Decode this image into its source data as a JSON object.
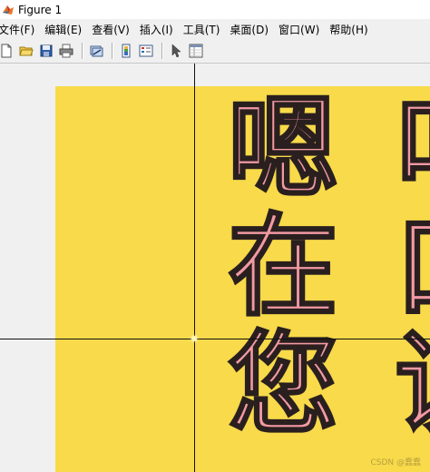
{
  "window": {
    "title": "Figure 1"
  },
  "menu": {
    "items": [
      {
        "label": "文件(F)"
      },
      {
        "label": "编辑(E)"
      },
      {
        "label": "查看(V)"
      },
      {
        "label": "插入(I)"
      },
      {
        "label": "工具(T)"
      },
      {
        "label": "桌面(D)"
      },
      {
        "label": "窗口(W)"
      },
      {
        "label": "帮助(H)"
      }
    ]
  },
  "toolbar": {
    "buttons": [
      {
        "icon": "new-figure-icon"
      },
      {
        "icon": "open-folder-icon"
      },
      {
        "icon": "save-icon"
      },
      {
        "icon": "print-icon"
      },
      {
        "icon": "link-plot-icon"
      },
      {
        "icon": "colorbar-icon"
      },
      {
        "icon": "legend-icon"
      },
      {
        "icon": "pointer-icon"
      },
      {
        "icon": "property-inspector-icon"
      }
    ]
  },
  "figure": {
    "background_color": "#f8da4a",
    "glyph_fill_color": "#f29aa3",
    "glyph_stroke_color": "#2a1f1f",
    "glyphs": {
      "col1_row1": "嗯",
      "col1_row2": "在",
      "col1_row3": "您",
      "col2_row1": "叫",
      "col2_row2": "口",
      "col2_row3": "说"
    },
    "watermark": "CSDN @蠢蠢"
  }
}
